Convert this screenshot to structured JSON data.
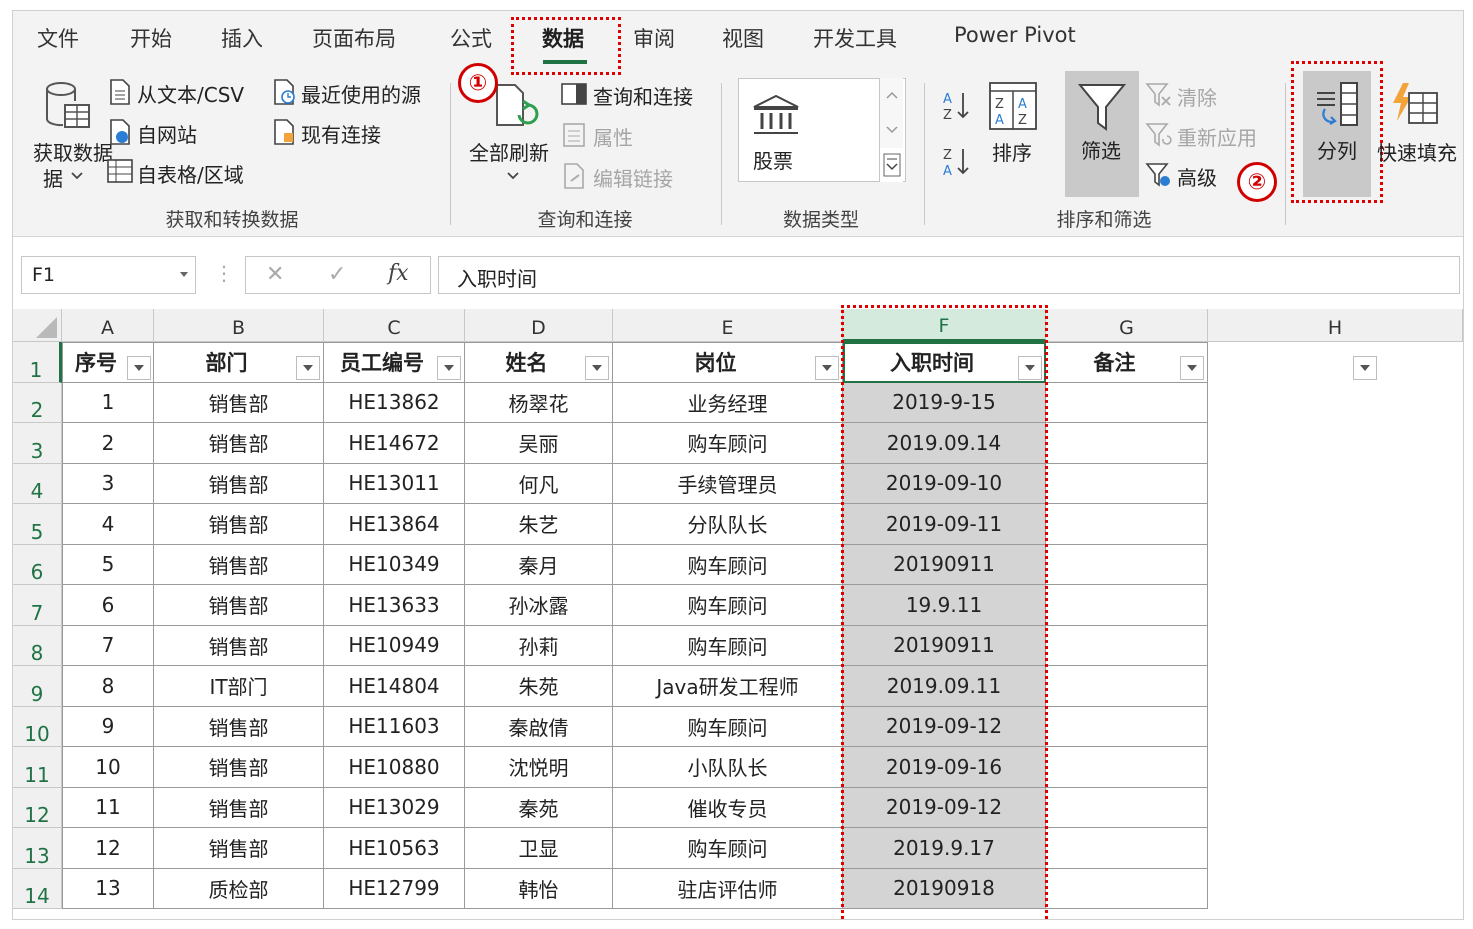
{
  "tabs": [
    "文件",
    "开始",
    "插入",
    "页面布局",
    "公式",
    "数据",
    "审阅",
    "视图",
    "开发工具",
    "Power Pivot"
  ],
  "active_tab": "数据",
  "groups": {
    "get_transform": {
      "label": "获取和转换数据",
      "get_data": "获取数据",
      "get_data_2": "据",
      "from_text": "从文本/CSV",
      "from_web": "自网站",
      "from_table": "自表格/区域",
      "recent_sources": "最近使用的源",
      "existing_connections": "现有连接"
    },
    "queries": {
      "label": "查询和连接",
      "refresh_all": "全部刷新",
      "queries_connections": "查询和连接",
      "properties": "属性",
      "edit_links": "编辑链接"
    },
    "data_types": {
      "label": "数据类型",
      "stocks": "股票"
    },
    "sort_filter": {
      "label": "排序和筛选",
      "sort": "排序",
      "filter": "筛选",
      "clear": "清除",
      "reapply": "重新应用",
      "advanced": "高级"
    },
    "data_tools": {
      "text_to_columns": "分列",
      "flash_fill": "快速填充"
    }
  },
  "annotations": {
    "step1": "①",
    "step2": "②"
  },
  "name_box": "F1",
  "formula_bar": {
    "fx": "fx",
    "cancel": "✕",
    "enter": "✓",
    "content": "入职时间"
  },
  "columns": [
    "A",
    "B",
    "C",
    "D",
    "E",
    "F",
    "G",
    "H"
  ],
  "rows": [
    "1",
    "2",
    "3",
    "4",
    "5",
    "6",
    "7",
    "8",
    "9",
    "10",
    "11",
    "12",
    "13",
    "14"
  ],
  "table": {
    "headers": [
      "序号",
      "部门",
      "员工编号",
      "姓名",
      "岗位",
      "入职时间",
      "备注"
    ],
    "data": [
      [
        "1",
        "销售部",
        "HE13862",
        "杨翠花",
        "业务经理",
        "2019-9-15",
        ""
      ],
      [
        "2",
        "销售部",
        "HE14672",
        "吴丽",
        "购车顾问",
        "2019.09.14",
        ""
      ],
      [
        "3",
        "销售部",
        "HE13011",
        "何凡",
        "手续管理员",
        "2019-09-10",
        ""
      ],
      [
        "4",
        "销售部",
        "HE13864",
        "朱艺",
        "分队队长",
        "2019-09-11",
        ""
      ],
      [
        "5",
        "销售部",
        "HE10349",
        "秦月",
        "购车顾问",
        "20190911",
        ""
      ],
      [
        "6",
        "销售部",
        "HE13633",
        "孙冰露",
        "购车顾问",
        "19.9.11",
        ""
      ],
      [
        "7",
        "销售部",
        "HE10949",
        "孙莉",
        "购车顾问",
        "20190911",
        ""
      ],
      [
        "8",
        "IT部门",
        "HE14804",
        "朱苑",
        "Java研发工程师",
        "2019.09.11",
        ""
      ],
      [
        "9",
        "销售部",
        "HE11603",
        "秦啟倩",
        "购车顾问",
        "2019-09-12",
        ""
      ],
      [
        "10",
        "销售部",
        "HE10880",
        "沈悦明",
        "小队队长",
        "2019-09-16",
        ""
      ],
      [
        "11",
        "销售部",
        "HE13029",
        "秦苑",
        "催收专员",
        "2019-09-12",
        ""
      ],
      [
        "12",
        "销售部",
        "HE10563",
        "卫显",
        "购车顾问",
        "2019.9.17",
        ""
      ],
      [
        "13",
        "质检部",
        "HE12799",
        "韩怡",
        "驻店评估师",
        "20190918",
        ""
      ]
    ]
  },
  "colors": {
    "excel_green": "#217346",
    "annotation_red": "#d10000",
    "selected_column": "#d4d4d4"
  }
}
